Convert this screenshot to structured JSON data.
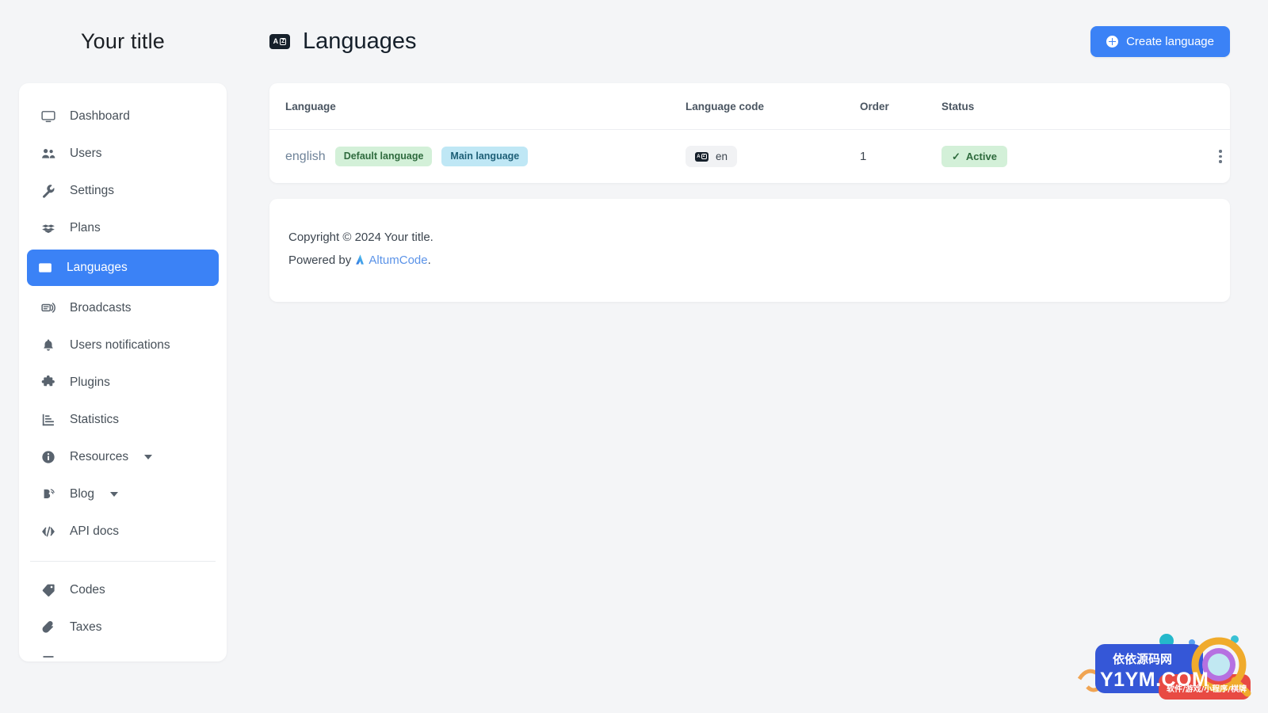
{
  "brand": {
    "title": "Your title"
  },
  "sidebar": {
    "items": [
      {
        "label": "Dashboard",
        "icon": "monitor-icon",
        "active": false,
        "caret": false
      },
      {
        "label": "Users",
        "icon": "users-icon",
        "active": false,
        "caret": false
      },
      {
        "label": "Settings",
        "icon": "wrench-icon",
        "active": false,
        "caret": false
      },
      {
        "label": "Plans",
        "icon": "boxes-icon",
        "active": false,
        "caret": false
      },
      {
        "label": "Languages",
        "icon": "translate-icon",
        "active": true,
        "caret": false
      },
      {
        "label": "Broadcasts",
        "icon": "broadcast-icon",
        "active": false,
        "caret": false
      },
      {
        "label": "Users notifications",
        "icon": "bell-icon",
        "active": false,
        "caret": false
      },
      {
        "label": "Plugins",
        "icon": "puzzle-icon",
        "active": false,
        "caret": false
      },
      {
        "label": "Statistics",
        "icon": "bar-chart-icon",
        "active": false,
        "caret": false
      },
      {
        "label": "Resources",
        "icon": "info-circle-icon",
        "active": false,
        "caret": true
      },
      {
        "label": "Blog",
        "icon": "blog-icon",
        "active": false,
        "caret": true
      },
      {
        "label": "API docs",
        "icon": "code-brackets-icon",
        "active": false,
        "caret": false
      }
    ],
    "items_after_separator": [
      {
        "label": "Codes",
        "icon": "tag-icon",
        "active": false,
        "caret": false
      },
      {
        "label": "Taxes",
        "icon": "paperclip-icon",
        "active": false,
        "caret": false
      }
    ]
  },
  "header": {
    "icon": "translate-icon",
    "title": "Languages",
    "create_button": {
      "label": "Create language",
      "icon": "plus-circle-icon"
    }
  },
  "table": {
    "columns": [
      "Language",
      "Language code",
      "Order",
      "Status"
    ],
    "rows": [
      {
        "language": "english",
        "badges": [
          {
            "text": "Default language",
            "style": "green"
          },
          {
            "text": "Main language",
            "style": "blue"
          }
        ],
        "language_code": "en",
        "code_icon": "translate-icon",
        "order": "1",
        "status": {
          "text": "Active",
          "icon": "check-icon",
          "style": "green"
        },
        "actions_icon": "kebab-menu-icon"
      }
    ]
  },
  "footer": {
    "copyright": "Copyright © 2024 Your title.",
    "powered_prefix": "Powered by ",
    "powered_link": "AltumCode",
    "powered_suffix": ".",
    "logo": "altumcode-logo-icon"
  },
  "watermark": {
    "site_cn": "依依源码网",
    "site_url": "Y1YM.COM",
    "tagline": "软件/游戏/小程序/棋牌",
    "icon": "magnifier-icon"
  },
  "colors": {
    "accent": "#3b82f6",
    "page_bg": "#f4f5f7",
    "card_bg": "#ffffff",
    "badge_green_bg": "#d3f0d8",
    "badge_blue_bg": "#bfe7f5",
    "link": "#5b93e8"
  }
}
